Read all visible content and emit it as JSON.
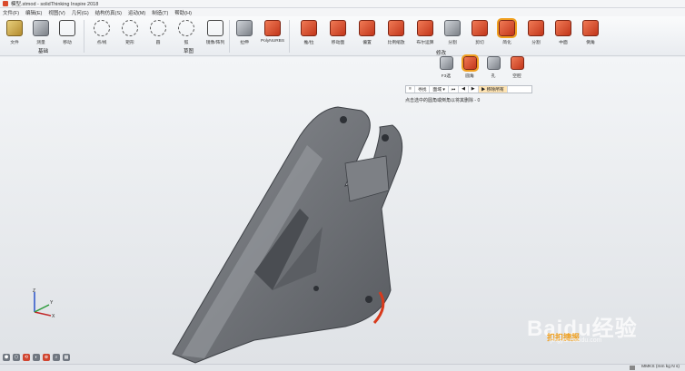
{
  "window": {
    "title": "模型.stmod - solidThinking Inspire 2018"
  },
  "menu": [
    "文件(F)",
    "编辑(E)",
    "视图(V)",
    "几何(G)",
    "结构仿真(S)",
    "运动(M)",
    "制造(T)",
    "帮助(H)"
  ],
  "ribbon": {
    "groups": [
      {
        "label": "基础"
      },
      {
        "label": "草图"
      },
      {
        "label": "修改"
      }
    ],
    "tools": [
      {
        "label": "文件",
        "icon": "folder-icon"
      },
      {
        "label": "测量",
        "icon": "measure-icon"
      },
      {
        "label": "移动",
        "icon": "move-icon"
      },
      {
        "label": "点/线",
        "icon": "point-line-icon"
      },
      {
        "label": "矩形",
        "icon": "rectangle-icon"
      },
      {
        "label": "圆",
        "icon": "circle-icon"
      },
      {
        "label": "弧",
        "icon": "arc-icon"
      },
      {
        "label": "镜像/阵列",
        "icon": "mirror-icon"
      },
      {
        "label": "拉伸",
        "icon": "extrude-icon"
      },
      {
        "label": "PolyNURBS",
        "icon": "polynurbs-icon"
      },
      {
        "label": "推/拉",
        "icon": "push-pull-icon"
      },
      {
        "label": "移动面",
        "icon": "move-face-icon"
      },
      {
        "label": "偏置",
        "icon": "offset-icon"
      },
      {
        "label": "比例缩放",
        "icon": "scale-icon"
      },
      {
        "label": "布尔运算",
        "icon": "boolean-icon"
      },
      {
        "label": "分割",
        "icon": "split-icon"
      },
      {
        "label": "剪切",
        "icon": "cut-icon"
      },
      {
        "label": "简化",
        "icon": "simplify-icon",
        "active": true
      },
      {
        "label": "分割",
        "icon": "split-body-icon"
      },
      {
        "label": "中面",
        "icon": "midsurface-icon"
      },
      {
        "label": "倒角",
        "icon": "chamfer-icon"
      }
    ]
  },
  "sub_toolbar": {
    "label": "修改",
    "tools": [
      {
        "label": "F3选",
        "icon": "select-icon"
      },
      {
        "label": "圆角",
        "icon": "fillet-icon",
        "active": true
      },
      {
        "label": "孔",
        "icon": "hole-icon"
      },
      {
        "label": "空腔",
        "icon": "cavity-icon"
      }
    ]
  },
  "hint_bar": {
    "cells": [
      {
        "text": "≡"
      },
      {
        "text": "寻找"
      },
      {
        "text": "面域 ▾"
      },
      {
        "text": "⏮"
      },
      {
        "text": "◀"
      },
      {
        "text": "▶"
      },
      {
        "text": "▶ 移除所有",
        "selected": true
      }
    ],
    "message": "点击选中的圆角或倒角以将其删除 - 0"
  },
  "triad": {
    "x": "X",
    "y": "Y",
    "z": "Z"
  },
  "view_tools": [
    "⬢",
    "⬡",
    "⟲",
    "◐",
    "⊕",
    "⌕",
    "▦"
  ],
  "status": {
    "units": "MMKS (mm kg N s)"
  },
  "watermark": {
    "main": "Baidu经验",
    "sub": "jingyan.baidu.com",
    "badge": "扣扣捷报"
  },
  "colors": {
    "accent": "#d94a2c",
    "highlight": "#f0a020",
    "part": "#6b6e73"
  }
}
